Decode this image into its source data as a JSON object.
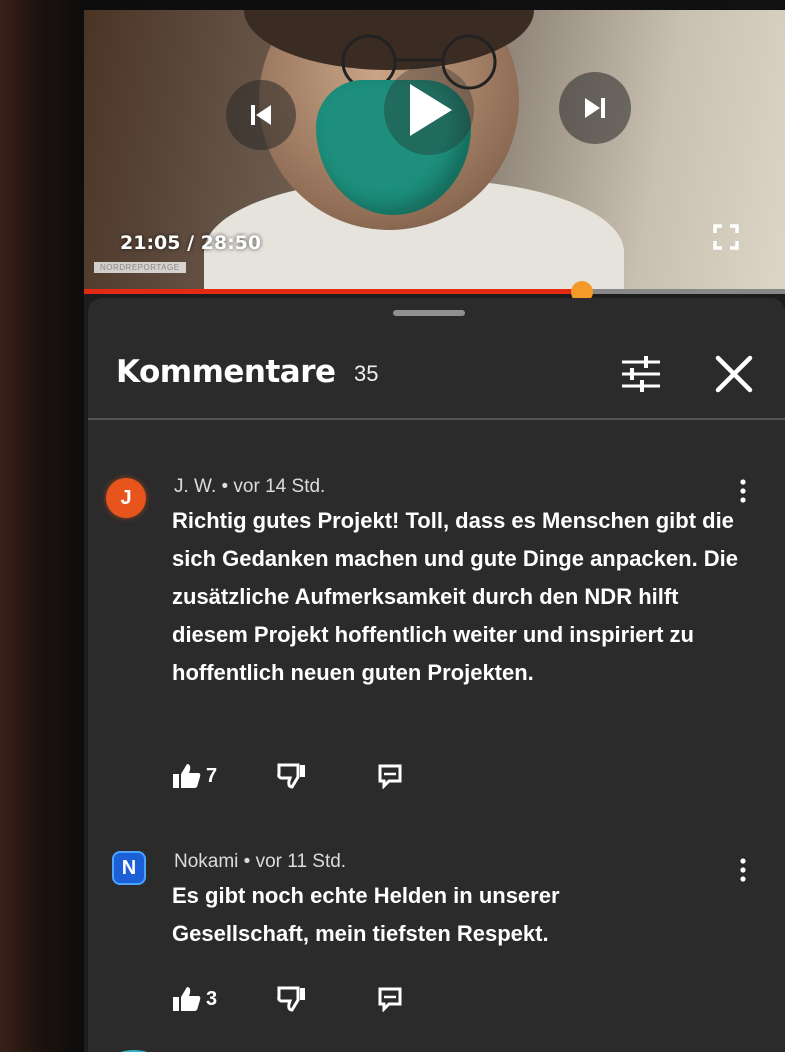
{
  "video": {
    "time": "21:05 / 28:50",
    "watermark": "NORDREPORTAGE",
    "progress_fraction": 0.71,
    "colors": {
      "progress": "#e52a12",
      "knob": "#f39a28"
    },
    "controls": [
      "previous-icon",
      "play-icon",
      "next-icon",
      "fullscreen-icon"
    ]
  },
  "comments_panel": {
    "title": "Kommentare",
    "count": "35",
    "filter_icon": "filter-sliders-icon",
    "close_icon": "close-icon"
  },
  "comments": [
    {
      "avatar_letter": "J",
      "avatar_color": "#e8551c",
      "meta": "J. W. • vor 14 Std.",
      "text": "Richtig gutes Projekt! Toll, dass es Menschen gibt die sich Gedanken machen und gute Dinge anpacken. Die zusätzliche Aufmerksamkeit durch den NDR hilft diesem Projekt hoffentlich weiter und inspiriert zu hoffentlich neuen guten Projekten.",
      "likes": "7"
    },
    {
      "avatar_letter": "N",
      "avatar_color": "#1c5fd6",
      "meta": "Nokami • vor 11 Std.",
      "text": "Es gibt noch echte Helden in unserer Gesellschaft, mein tiefsten Respekt.",
      "likes": "3"
    }
  ]
}
